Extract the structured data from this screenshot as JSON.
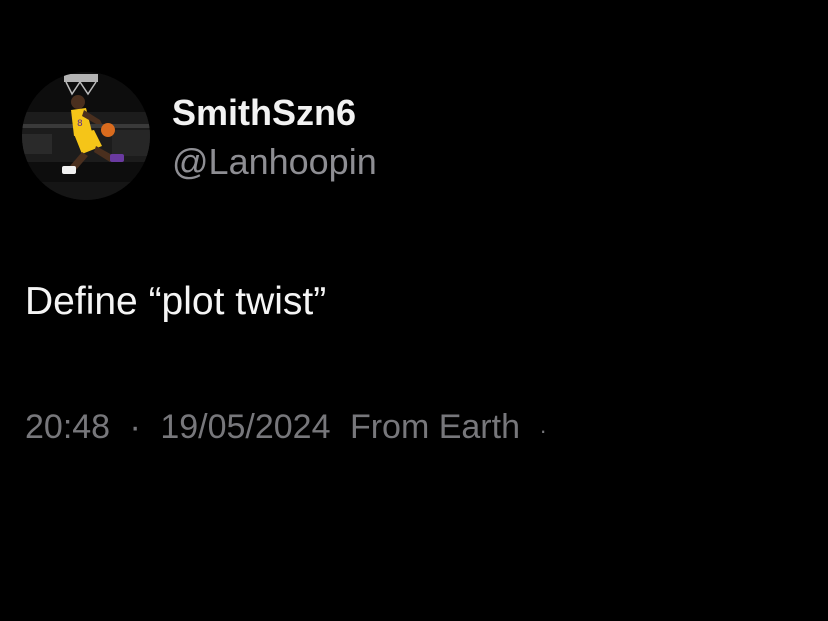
{
  "author": {
    "display_name": "SmithSzn6",
    "handle": "@Lanhoopin",
    "avatar_icon": "basketball-player-dunk-avatar"
  },
  "tweet": {
    "text": "Define “plot twist”"
  },
  "meta": {
    "time": "20:48",
    "separator": "·",
    "date": "19/05/2024",
    "source": "From Earth",
    "trailing_separator": "·"
  },
  "colors": {
    "background": "#000000",
    "primary_text": "#f2f2f2",
    "secondary_text": "#8e8e93",
    "meta_text": "#77777b",
    "jersey_yellow": "#f5c518"
  }
}
